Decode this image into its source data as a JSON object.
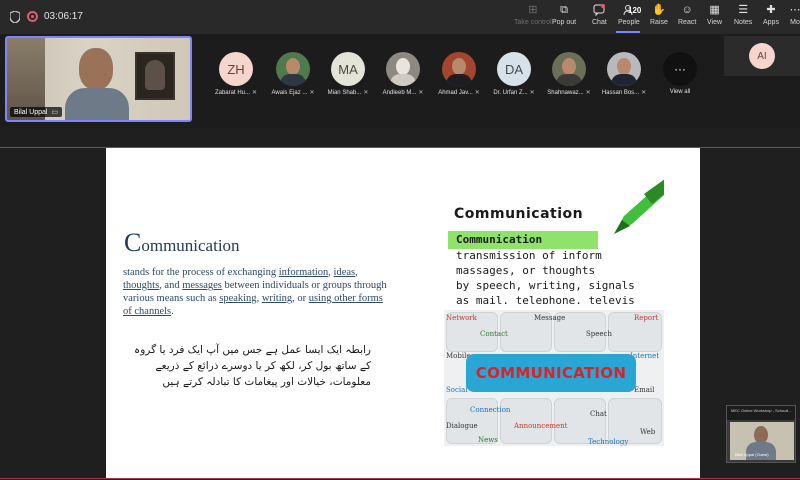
{
  "meeting": {
    "timer": "03:06:17",
    "colors": {
      "accent": "#7f85f5",
      "recording": "#e8576b",
      "divider": "#a5374c"
    }
  },
  "toolbar": {
    "take_control": "Take control",
    "pop_out": "Pop out",
    "chat": "Chat",
    "people": "People",
    "people_count": "120",
    "raise": "Raise",
    "react": "React",
    "view": "View",
    "notes": "Notes",
    "apps": "Apps",
    "more": "Mo"
  },
  "main_video": {
    "name": "Bilal Uppal"
  },
  "participants": [
    {
      "initials": "ZH",
      "label": "Zabarat Hu..."
    },
    {
      "initials": "",
      "label": "Awais Ejaz ..."
    },
    {
      "initials": "MA",
      "label": "Mian Shab..."
    },
    {
      "initials": "",
      "label": "Andleeb M..."
    },
    {
      "initials": "",
      "label": "Ahmad Jav..."
    },
    {
      "initials": "DA",
      "label": "Dr. Urfan Z..."
    },
    {
      "initials": "",
      "label": "Shahnawaz..."
    },
    {
      "initials": "",
      "label": "Hassan Bos..."
    }
  ],
  "view_all": {
    "icon": "···",
    "label": "View all"
  },
  "ai_tile": {
    "initials": "AI"
  },
  "slide": {
    "title_cap": "C",
    "title_rest": "ommunication",
    "body_1": "stands for the process of exchanging ",
    "link_information": "information",
    "sep_1": ", ",
    "link_ideas": "ideas",
    "sep_2": ",",
    "link_thoughts": "thoughts",
    "body_2": ", and ",
    "link_messages": "messages",
    "body_3": " between individuals or groups through various means such as ",
    "link_speaking": "speaking",
    "sep_3": ", ",
    "link_writing": "writing",
    "body_4": ", or ",
    "link_other": "using other forms of channels",
    "body_5": ".",
    "urdu": "رابطہ ایک ایسا عمل ہے جس میں آپ ایک فرد یا گروہ کے ساتھ بول کر، لکھ کر یا دوسرے ذرائع کے ذریعے معلومات، خیالات اور پیغامات کا تبادلہ کرتے ہیں"
  },
  "marker_image": {
    "heading": "Communication",
    "highlight": "Communication",
    "line_1": "transmission of inform",
    "line_2": "massages, or thoughts",
    "line_3": "by speech, writing, signals",
    "line_4": "as mail, telephone, televis"
  },
  "puzzle_image": {
    "banner": "COMMUNICATION",
    "words": {
      "network": "Network",
      "message": "Message",
      "report": "Report",
      "contact": "Contact",
      "speech": "Speech",
      "mobile": "Mobile",
      "internet": "Internet",
      "social": "Social",
      "email": "Email",
      "connection": "Connection",
      "chat": "Chat",
      "dialogue": "Dialogue",
      "announcement": "Announcement",
      "web": "Web",
      "news": "News",
      "technology": "Technology"
    }
  },
  "self_view": {
    "title": "MEC Online Workshop - Schooli...",
    "name": "Bilal Uppal (Guest)"
  }
}
